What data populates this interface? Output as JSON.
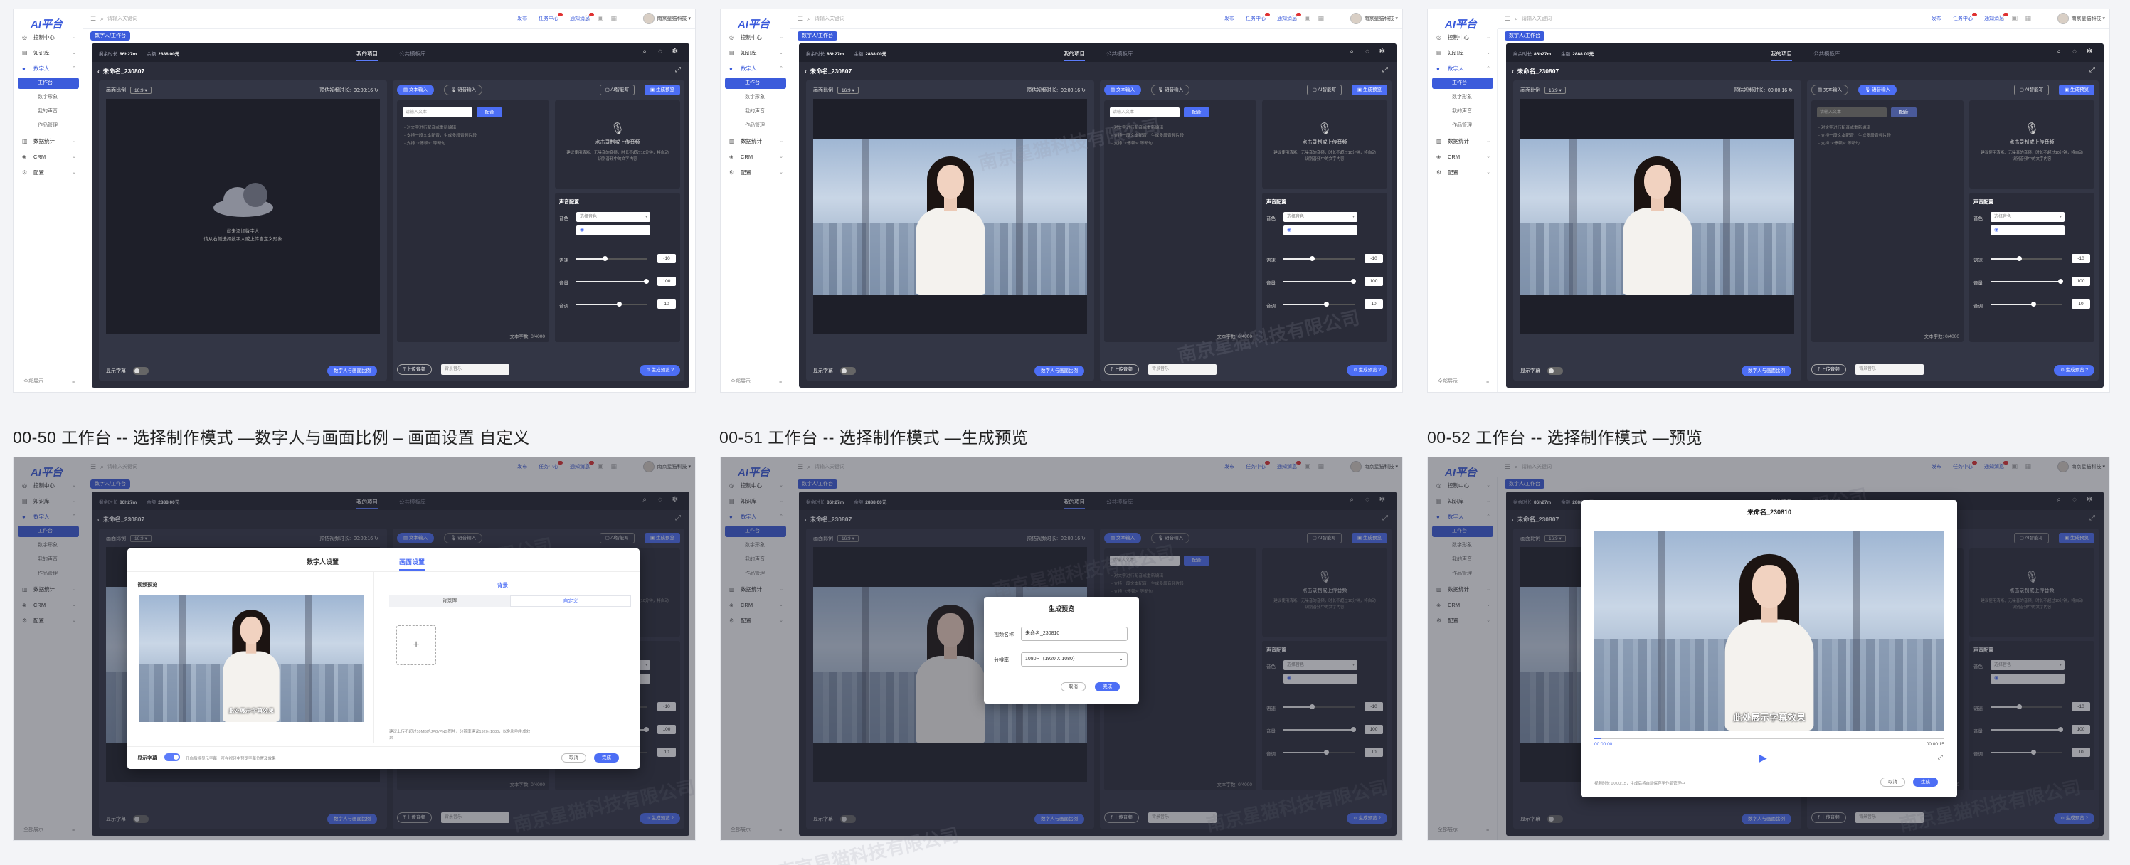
{
  "app": {
    "logo": "AI平台",
    "search_placeholder": "请输入关键词",
    "top_links": [
      "发布",
      "任务中心",
      "通知消息"
    ],
    "user_name": "南京星猫科技"
  },
  "sidebar": {
    "items": [
      "控制中心",
      "知识库",
      "数字人",
      "工作台",
      "数字形象",
      "我的声音",
      "作品管理",
      "数据统计",
      "CRM",
      "配置"
    ],
    "footer_left": "全部展示",
    "footer_right": "≡"
  },
  "tag_bar": {
    "tag": "数字人/工作台"
  },
  "header": {
    "stat_label_1": "剩余时长",
    "stat_value_1": "86h27m",
    "stat_label_2": "余额",
    "stat_value_2": "2888.00元",
    "tab_1": "我的项目",
    "tab_2": "公共模板库",
    "search_icon": "search-icon",
    "settings_icon": "gear-icon"
  },
  "project": {
    "name": "未命名_230807",
    "name_alt": "未命名_230810"
  },
  "editor": {
    "ratio_label": "画面比例",
    "ratio_value": "16:9",
    "duration_label": "预估视频时长",
    "duration_value": "00:00:16",
    "placeholder_title": "尚未添加数字人",
    "placeholder_desc": "请从右侧选择数字人或上传自定义形象",
    "subtitle_label": "显示字幕",
    "subtitle_sample": "此处展示字幕效果",
    "avatar_button": "数字人与画面比例"
  },
  "tools": {
    "chip_text": "文本输入",
    "chip_voice": "语音输入",
    "btn_ai": "AI智能写",
    "btn_preview": "生成预览",
    "ta_placeholder": "请输入文本",
    "ta_button": "配音",
    "ta_lines": [
      "- 对文字进行配音或重新编辑",
      "- 支持一段文本配音，生成多段音频片段",
      "- 支持 “&lt;停顿&gt;” 等断句"
    ],
    "char_count": "文本字数: 0/4000",
    "voice_title": "点击录制或上传音频",
    "voice_desc": "建议使用清晰、无噪音的音频，时长不超过10分钟，将自动识别音频中的文字内容",
    "sound_title": "声音配置",
    "tone_label": "音色",
    "tone_value": "选择音色",
    "tone_play": "◉",
    "speed_label": "语速",
    "speed_value": "-10",
    "volume_label": "音量",
    "volume_value": "100",
    "pitch_label": "音调",
    "pitch_value": "10",
    "upload_label": "上传音频",
    "mute_label": "背景音乐",
    "gen_button": "生成预览"
  },
  "captions": [
    "00-50 工作台 -- 选择制作模式 —数字人与画面比例 – 画面设置 自定义",
    "00-51 工作台 -- 选择制作模式 —生成预览",
    "00-52 工作台 -- 选择制作模式 —预览"
  ],
  "modal_settings": {
    "tab_1": "数字人设置",
    "tab_2": "画面设置",
    "section_left": "视频预览",
    "section_right": "背景",
    "seg_1": "背景库",
    "seg_2": "自定义",
    "upload_plus": "+",
    "note": "建议上传不超过10MB的JPG/PNG图片，分辨率建议1920×1080，以免影响生成效果",
    "subtitle_label": "显示字幕",
    "subtitle_note": "开启后将显示字幕，可在视频中预览字幕位置及效果",
    "cancel": "取消",
    "confirm": "完成"
  },
  "modal_generate": {
    "title": "生成预览",
    "name_label": "视频名称",
    "name_value": "未命名_230810",
    "res_label": "分辨率",
    "res_value": "1080P（1920 X 1080）",
    "cancel": "取消",
    "confirm": "完成"
  },
  "modal_preview": {
    "time_start": "00:00:00",
    "time_end": "00:00:15",
    "play_icon": "play-icon",
    "note": "视频时长 00:00:15，生成后将自动保存至作品管理中",
    "cancel": "取消",
    "confirm": "生成"
  },
  "watermark": "南京星猫科技有限公司",
  "progress": {
    "preview_played": 0.02
  },
  "colors": {
    "accent": "#4c6ef5",
    "dark_bg": "#2b2d3a",
    "panel_bg": "#333645"
  }
}
